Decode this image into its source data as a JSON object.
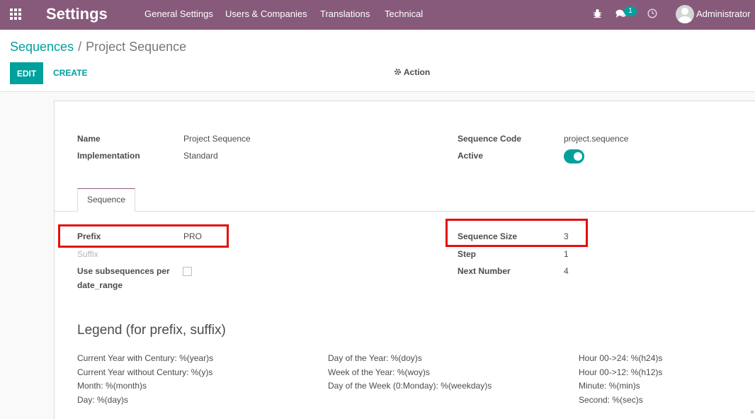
{
  "navbar": {
    "apps_icon": "grid-icon",
    "brand": "Settings",
    "menus": [
      "General Settings",
      "Users & Companies",
      "Translations",
      "Technical"
    ],
    "debug_icon": "bug-icon",
    "chat_icon": "chat-icon",
    "chat_badge": "1",
    "activity_icon": "clock-icon",
    "user": "Administrator",
    "bg_color": "#875a7b"
  },
  "breadcrumb": {
    "parent": "Sequences",
    "separator": "/",
    "current": "Project Sequence"
  },
  "buttons": {
    "edit": "EDIT",
    "create": "CREATE",
    "action": "Action",
    "action_icon": "gear-icon",
    "accent_color": "#00a09d"
  },
  "form": {
    "name_label": "Name",
    "name_value": "Project Sequence",
    "implementation_label": "Implementation",
    "implementation_value": "Standard",
    "code_label": "Sequence Code",
    "code_value": "project.sequence",
    "active_label": "Active",
    "active_value": true
  },
  "tabs": [
    "Sequence"
  ],
  "sequence_tab": {
    "prefix_label": "Prefix",
    "prefix_value": "PRO",
    "suffix_label": "Suffix",
    "subseq_label_1": "Use subsequences per",
    "subseq_label_2": "date_range",
    "subseq_checked": false,
    "size_label": "Sequence Size",
    "size_value": "3",
    "step_label": "Step",
    "step_value": "1",
    "next_label": "Next Number",
    "next_value": "4",
    "highlight_color": "#e30e0e"
  },
  "legend": {
    "title": "Legend (for prefix, suffix)",
    "col1": [
      "Current Year with Century: %(year)s",
      "Current Year without Century: %(y)s",
      "Month: %(month)s",
      "Day: %(day)s"
    ],
    "col2": [
      "Day of the Year: %(doy)s",
      "Week of the Year: %(woy)s",
      "Day of the Week (0:Monday): %(weekday)s"
    ],
    "col3": [
      "Hour 00->24: %(h24)s",
      "Hour 00->12: %(h12)s",
      "Minute: %(min)s",
      "Second: %(sec)s"
    ]
  }
}
